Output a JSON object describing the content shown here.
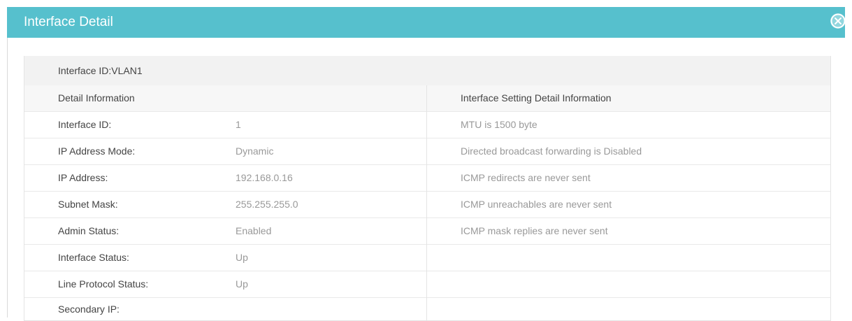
{
  "header": {
    "title": "Interface Detail"
  },
  "interface_id_line": "Interface ID:VLAN1",
  "left": {
    "heading": "Detail Information",
    "rows": [
      {
        "label": "Interface ID:",
        "value": "1"
      },
      {
        "label": "IP Address Mode:",
        "value": "Dynamic"
      },
      {
        "label": "IP Address:",
        "value": "192.168.0.16"
      },
      {
        "label": "Subnet Mask:",
        "value": "255.255.255.0"
      },
      {
        "label": "Admin Status:",
        "value": "Enabled"
      },
      {
        "label": "Interface Status:",
        "value": "Up"
      },
      {
        "label": "Line Protocol Status:",
        "value": "Up"
      },
      {
        "label": "Secondary IP:",
        "value": ""
      }
    ]
  },
  "right": {
    "heading": "Interface Setting Detail Information",
    "rows": [
      "MTU is 1500 byte",
      "Directed broadcast forwarding is Disabled",
      "ICMP redirects are never sent",
      "ICMP unreachables are never sent",
      "ICMP mask replies are never sent",
      "",
      "",
      ""
    ]
  },
  "colors": {
    "header_bg": "#56c0cd",
    "label_text": "#444444",
    "value_text": "#999999"
  },
  "icons": {
    "close": "close-circle-icon"
  }
}
